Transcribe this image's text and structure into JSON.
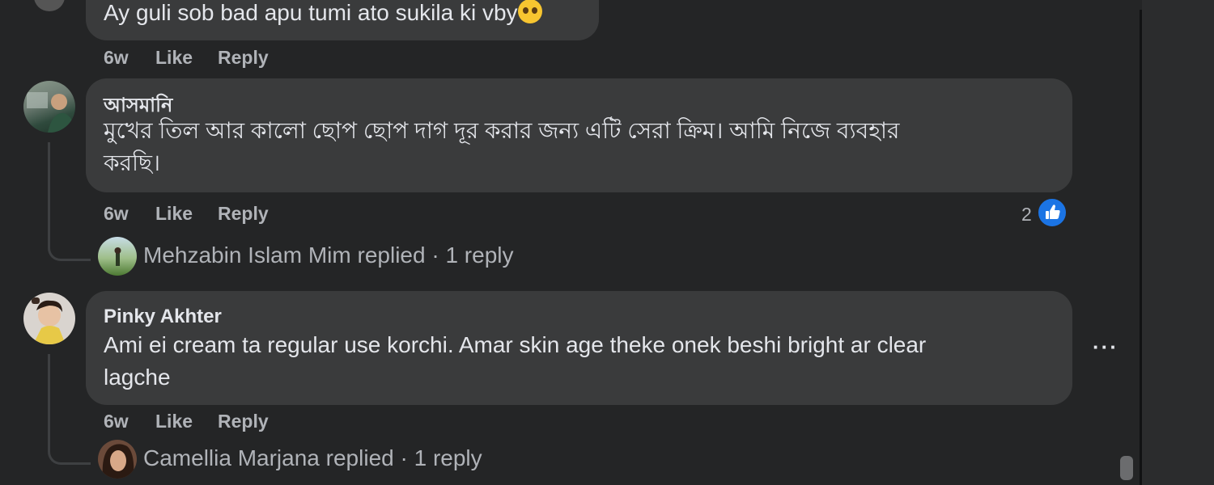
{
  "comments": [
    {
      "text": "Ay guli sob bad apu tumi ato sukila ki vby",
      "emoji": "pleading-face-emoji",
      "time": "6w",
      "like_label": "Like",
      "reply_label": "Reply"
    },
    {
      "author": "আসমানি",
      "text_line1": "মুখের তিল আর কালো ছোপ ছোপ দাগ দূর করার জন্য এটি সেরা ক্রিম। আমি নিজে ব্যবহার",
      "text_line2": "করছি।",
      "time": "6w",
      "like_label": "Like",
      "reply_label": "Reply",
      "reaction_count": "2",
      "reaction_icon": "thumbs-up-icon",
      "reply_summary": {
        "name": "Mehzabin Islam Mim",
        "suffix": "replied · 1 reply"
      }
    },
    {
      "author": "Pinky Akhter",
      "text_line1": "Ami ei cream ta regular use korchi. Amar skin age theke onek beshi bright ar clear",
      "text_line2": "lagche",
      "time": "6w",
      "like_label": "Like",
      "reply_label": "Reply",
      "more_label": "···",
      "reply_summary": {
        "name": "Camellia Marjana",
        "suffix": "replied · 1 reply"
      }
    }
  ],
  "colors": {
    "background": "#242526",
    "bubble": "#3a3b3c",
    "primary_text": "#e4e6eb",
    "secondary_text": "#b0b3b8",
    "like_blue": "#1b74e4"
  }
}
